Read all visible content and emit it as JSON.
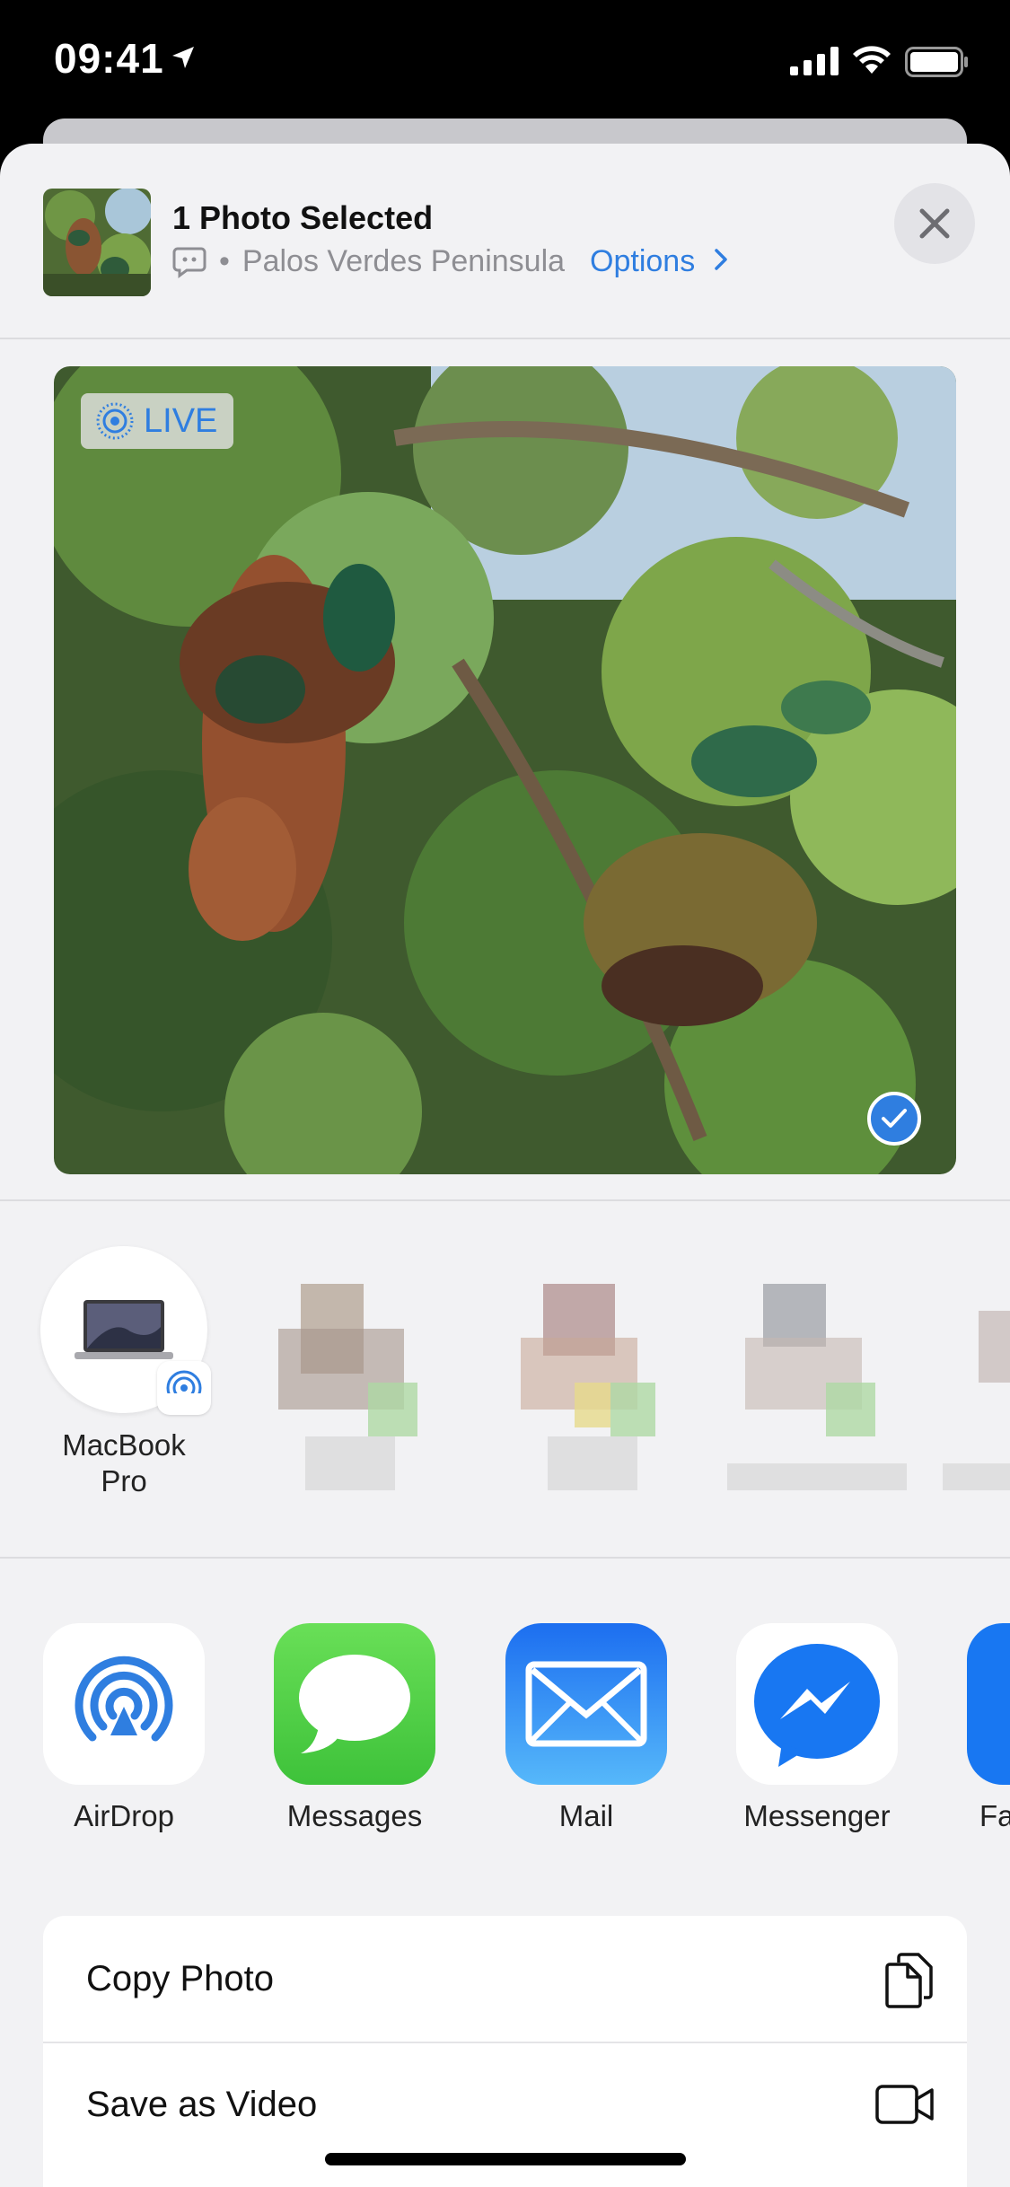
{
  "status_bar": {
    "time": "09:41"
  },
  "share_header": {
    "title": "1 Photo Selected",
    "location": "Palos Verdes Peninsula",
    "options_label": "Options"
  },
  "photo": {
    "live_label": "LIVE",
    "selected": true
  },
  "airdrop_targets": [
    {
      "label_line1": "MacBook",
      "label_line2": "Pro"
    }
  ],
  "apps": [
    {
      "label": "AirDrop",
      "color": "#2f7ee0"
    },
    {
      "label": "Messages",
      "color": "#4cd964"
    },
    {
      "label": "Mail",
      "color": "#2d8cf0"
    },
    {
      "label": "Messenger",
      "color": "#1877f2"
    },
    {
      "label": "Fa"
    }
  ],
  "actions": [
    {
      "label": "Copy Photo",
      "icon": "copy-icon"
    },
    {
      "label": "Save as Video",
      "icon": "video-icon"
    }
  ]
}
